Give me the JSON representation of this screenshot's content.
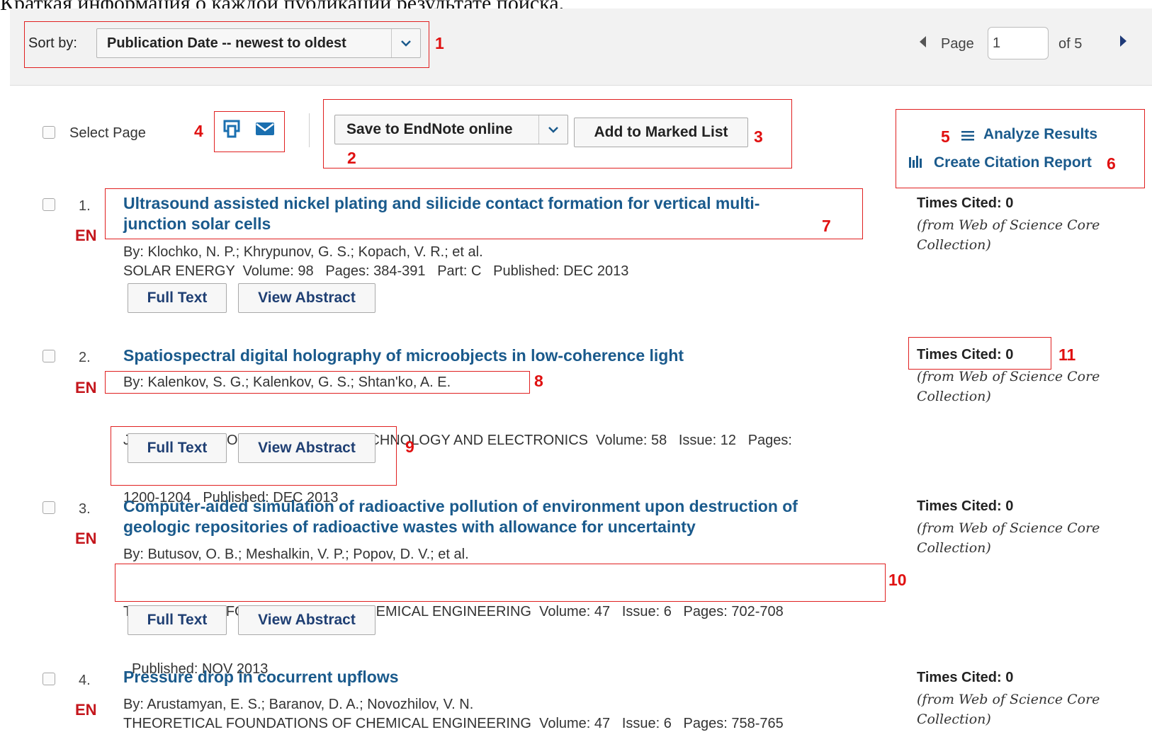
{
  "caption": "Краткая информация о каждой публикации результате поиска.",
  "sort": {
    "label": "Sort by:",
    "selected": "Publication Date -- newest to oldest"
  },
  "pager": {
    "page_label": "Page",
    "current": "1",
    "of_label": "of 5"
  },
  "toolbar": {
    "select_page_label": "Select Page",
    "save_label": "Save to EndNote online",
    "marked_list_label": "Add to Marked List",
    "analyze_label": "Analyze Results",
    "citation_report_label": "Create Citation Report"
  },
  "annotations": [
    "1",
    "2",
    "3",
    "4",
    "5",
    "6",
    "7",
    "8",
    "9",
    "10",
    "11"
  ],
  "buttons": {
    "full_text": "Full Text",
    "view_abstract": "View Abstract"
  },
  "results": [
    {
      "index": "1.",
      "lang": "EN",
      "title_line1": "Ultrasound assisted nickel plating and silicide contact formation for vertical multi-",
      "title_line2": "junction solar cells",
      "authors": "By: Klochko, N. P.; Khrypunov, G. S.; Kopach, V. R.; et al.",
      "source_line1": "SOLAR ENERGY  Volume: 98   Pages: 384-391   Part: C   Published: DEC 2013",
      "times_cited": "Times Cited: 0",
      "from_line1": "(from Web of Science Core",
      "from_line2": "Collection)"
    },
    {
      "index": "2.",
      "lang": "EN",
      "title_line1": "Spatiospectral digital holography of microobjects in low-coherence light",
      "authors": "By: Kalenkov, S. G.; Kalenkov, G. S.; Shtan'ko, A. E.",
      "source_line1": "JOURNAL OF COMMUNICATIONS TECHNOLOGY AND ELECTRONICS  Volume: 58   Issue: 12   Pages:",
      "source_line2": "1200-1204   Published: DEC 2013",
      "times_cited": "Times Cited: 0",
      "from_line1": "(from Web of Science Core",
      "from_line2": "Collection)"
    },
    {
      "index": "3.",
      "lang": "EN",
      "title_line1": "Computer-aided simulation of radioactive pollution of environment upon destruction of",
      "title_line2": "geologic repositories of radioactive wastes with allowance for uncertainty",
      "authors": "By: Butusov, O. B.; Meshalkin, V. P.; Popov, D. V.; et al.",
      "source_line1": "THEORETICAL FOUNDATIONS OF CHEMICAL ENGINEERING  Volume: 47   Issue: 6   Pages: 702-708",
      "source_line2": "Published: NOV 2013",
      "times_cited": "Times Cited: 0",
      "from_line1": "(from Web of Science Core",
      "from_line2": "Collection)"
    },
    {
      "index": "4.",
      "lang": "EN",
      "title_line1": "Pressure drop in cocurrent upflows",
      "authors": "By: Arustamyan, E. S.; Baranov, D. A.; Novozhilov, V. N.",
      "source_line1": "THEORETICAL FOUNDATIONS OF CHEMICAL ENGINEERING  Volume: 47   Issue: 6   Pages: 758-765",
      "times_cited": "Times Cited: 0",
      "from_line1": "(from Web of Science Core",
      "from_line2": "Collection)"
    }
  ],
  "colors": {
    "link": "#1a5a8c",
    "annotation": "#e01010",
    "lang_badge": "#c4161c"
  }
}
